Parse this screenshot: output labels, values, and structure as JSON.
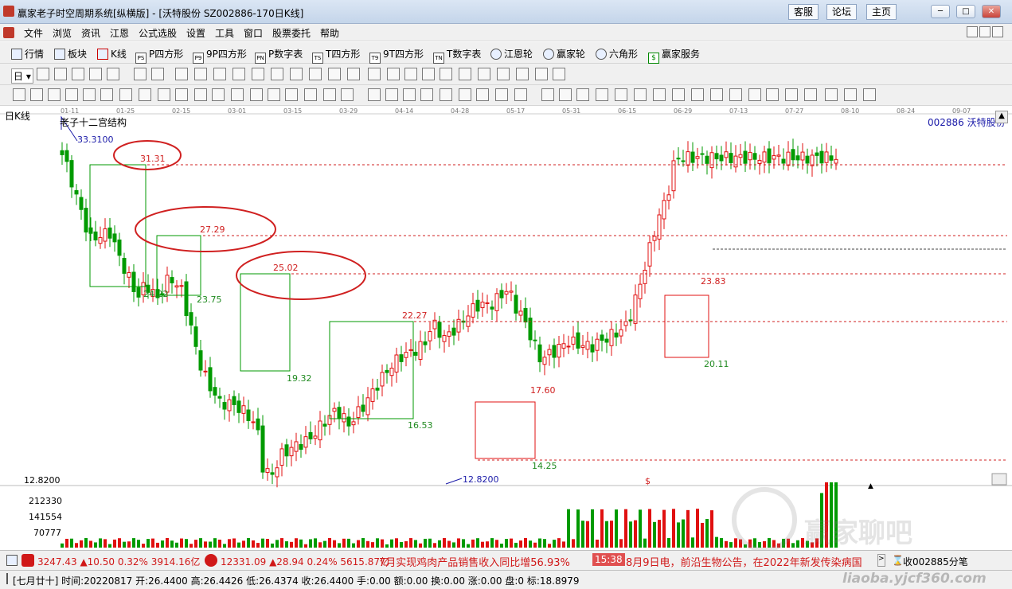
{
  "titlebar": {
    "title": "赢家老子时空周期系统[纵横版] - [沃特股份   SZ002886-170日K线]",
    "links": [
      "客服",
      "论坛",
      "主页"
    ]
  },
  "menu": [
    "文件",
    "浏览",
    "资讯",
    "江恩",
    "公式选股",
    "设置",
    "工具",
    "窗口",
    "股票委托",
    "帮助"
  ],
  "toolbar1": [
    "行情",
    "板块",
    "K线",
    "P四方形",
    "9P四方形",
    "P数字表",
    "T四方形",
    "9T四方形",
    "T数字表",
    "江恩轮",
    "赢家轮",
    "六角形",
    "赢家服务"
  ],
  "toolbar1_icons": [
    "PS",
    "P9",
    "PN",
    "TS",
    "T9",
    "TN"
  ],
  "period_selector": "日",
  "chart": {
    "period_label": "日K线",
    "indicator_title": "老子十二宫结构",
    "stock_label": "002886  沃特股份",
    "dates": [
      "01-11",
      "01-25",
      "02-15",
      "03-01",
      "03-15",
      "03-29",
      "04-14",
      "04-28",
      "05-17",
      "05-31",
      "06-15",
      "06-29",
      "07-13",
      "07-27",
      "08-10",
      "08-24",
      "09-07"
    ],
    "high_label": "33.3100",
    "low_label": "12.8200",
    "price_axis_label": "12.8200",
    "level_labels": [
      "31.31",
      "27.29",
      "25.02",
      "22.27",
      "17.60",
      "23.83",
      "24.22",
      "23.75",
      "19.32",
      "16.53",
      "14.25",
      "20.11"
    ],
    "dollar_mark": "$",
    "volume_axis": [
      "212330",
      "141554",
      "70777"
    ]
  },
  "status": {
    "sh_index": "3247.43 ▲10.50 0.32% 3914.16亿",
    "sz_index": "12331.09 ▲28.94 0.24% 5615.87亿",
    "news1": "7月实现鸡肉产品销售收入同比增56.93%",
    "news_time": "15:38",
    "news2": "8月9日电，前沿生物公告，在2022年新发传染病国",
    "trade_count": "收002885分笔"
  },
  "bottom": {
    "info": "[七月廿十] 时间:20220817 开:26.4400 高:26.4426 低:26.4374 收:26.4400 手:0.00 额:0.00 换:0.00 涨:0.00 盘:0 标:18.8979"
  },
  "watermark": {
    "text": "赢家聊吧",
    "url": "liaoba.yjcf360.com"
  },
  "colors": {
    "up": "#e01010",
    "down": "#009a00",
    "level": "#d02020",
    "low_text": "#1a1aa8"
  }
}
